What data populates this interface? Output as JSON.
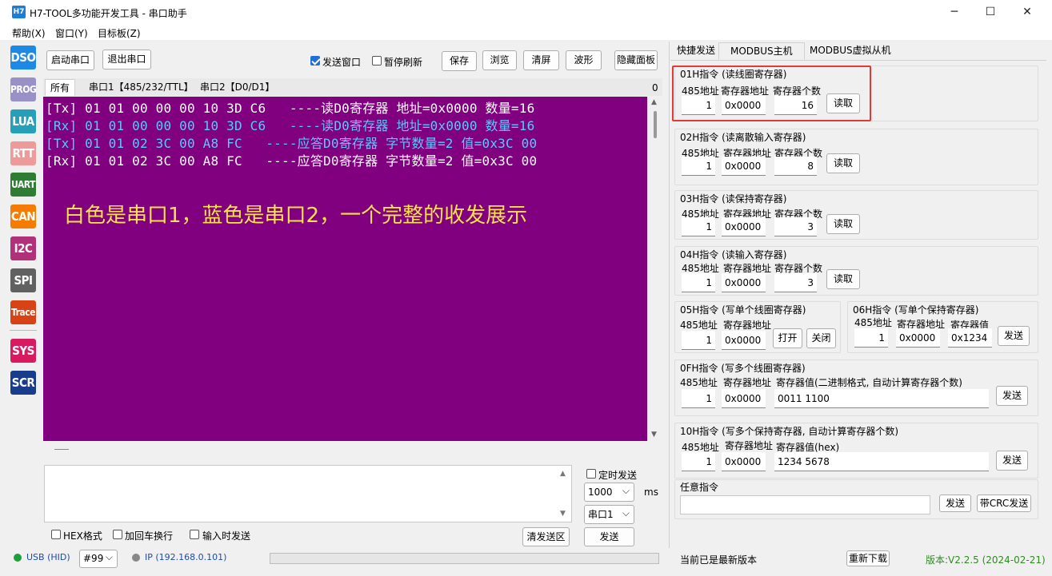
{
  "window": {
    "icon_text": "H7",
    "title": "H7-TOOL多功能开发工具 - 串口助手",
    "min": "─",
    "max": "☐",
    "close": "✕"
  },
  "menu": [
    "帮助(X)",
    "窗口(Y)",
    "目标板(Z)"
  ],
  "tools": [
    {
      "label": "DSO",
      "color": "#1e88e5"
    },
    {
      "label": "PROG",
      "color": "#9a90c8"
    },
    {
      "label": "LUA",
      "color": "#26a0b8"
    },
    {
      "label": "RTT",
      "color": "#ef9a9a"
    },
    {
      "label": "UART",
      "color": "#2e7d32"
    },
    {
      "label": "CAN",
      "color": "#f57c00"
    },
    {
      "label": "I2C",
      "color": "#b0307a"
    },
    {
      "label": "SPI",
      "color": "#616161"
    },
    {
      "label": "Trace",
      "color": "#d84315"
    },
    {
      "label": "SYS",
      "color": "#d81b60"
    },
    {
      "label": "SCR",
      "color": "#1a3c8c"
    }
  ],
  "toolbar": {
    "start": "启动串口",
    "stop": "退出串口",
    "send_window": "发送窗口",
    "pause_refresh": "暂停刷新",
    "save": "保存",
    "browse": "浏览",
    "clear": "清屏",
    "wave": "波形",
    "hide_panel": "隐藏面板"
  },
  "left_tabs": [
    "所有",
    "串口1【485/232/TTL】",
    "串口2【D0/D1】"
  ],
  "left_tab_count": "0",
  "terminal": {
    "lines": [
      {
        "text": "[Tx] 01 01 00 00 00 10 3D C6   ----读D0寄存器 地址=0x0000 数量=16",
        "color": "#ffffff"
      },
      {
        "text": "[Rx] 01 01 00 00 00 10 3D C6   ----读D0寄存器 地址=0x0000 数量=16",
        "color": "#5bc8ff"
      },
      {
        "text": "[Tx] 01 01 02 3C 00 A8 FC   ----应答D0寄存器 字节数量=2 值=0x3C 00",
        "color": "#5bc8ff"
      },
      {
        "text": "[Rx] 01 01 02 3C 00 A8 FC   ----应答D0寄存器 字节数量=2 值=0x3C 00",
        "color": "#ffffff"
      }
    ],
    "overlay": "白色是串口1，蓝色是串口2，一个完整的收发展示"
  },
  "send": {
    "timed_send": "定时发送",
    "interval": "1000",
    "unit": "ms",
    "port": "串口1",
    "hex": "HEX格式",
    "crlf": "加回车换行",
    "send_on_input": "输入时发送",
    "clear_send": "清发送区",
    "send": "发送"
  },
  "status": {
    "usb": "USB (HID)",
    "device": "#99",
    "ip": "IP (192.168.0.101)",
    "version_msg": "当前已是最新版本",
    "redownload": "重新下载",
    "version": "版本:V2.2.5 (2024-02-21)"
  },
  "right_tabs": [
    "快捷发送",
    "MODBUS主机",
    "MODBUS虚拟从机"
  ],
  "modbus": {
    "lbl_485": "485地址",
    "lbl_reg": "寄存器地址",
    "lbl_cnt": "寄存器个数",
    "read": "读取",
    "send": "发送",
    "g01": {
      "title": "01H指令 (读线圈寄存器)",
      "addr": "1",
      "reg": "0x0000",
      "cnt": "16"
    },
    "g02": {
      "title": "02H指令 (读离散输入寄存器)",
      "addr": "1",
      "reg": "0x0000",
      "cnt": "8"
    },
    "g03": {
      "title": "03H指令 (读保持寄存器)",
      "addr": "1",
      "reg": "0x0000",
      "cnt": "3"
    },
    "g04": {
      "title": "04H指令 (读输入寄存器)",
      "addr": "1",
      "reg": "0x0000",
      "cnt": "3"
    },
    "g05": {
      "title": "05H指令 (写单个线圈寄存器)",
      "addr": "1",
      "reg": "0x0000",
      "open": "打开",
      "close": "关闭"
    },
    "g06": {
      "title": "06H指令 (写单个保持寄存器)",
      "addr": "1",
      "reg": "0x0000",
      "val_lbl": "寄存器值",
      "val": "0x1234"
    },
    "g0f": {
      "title": "0FH指令 (写多个线圈寄存器)",
      "addr": "1",
      "reg": "0x0000",
      "val_lbl": "寄存器值(二进制格式, 自动计算寄存器个数)",
      "val": "0011 1100"
    },
    "g10": {
      "title": "10H指令 (写多个保持寄存器, 自动计算寄存器个数)",
      "addr": "1",
      "reg": "0x0000",
      "val_lbl": "寄存器值(hex)",
      "val": "1234 5678"
    },
    "any": {
      "title": "任意指令",
      "send": "发送",
      "crc_send": "带CRC发送"
    }
  }
}
